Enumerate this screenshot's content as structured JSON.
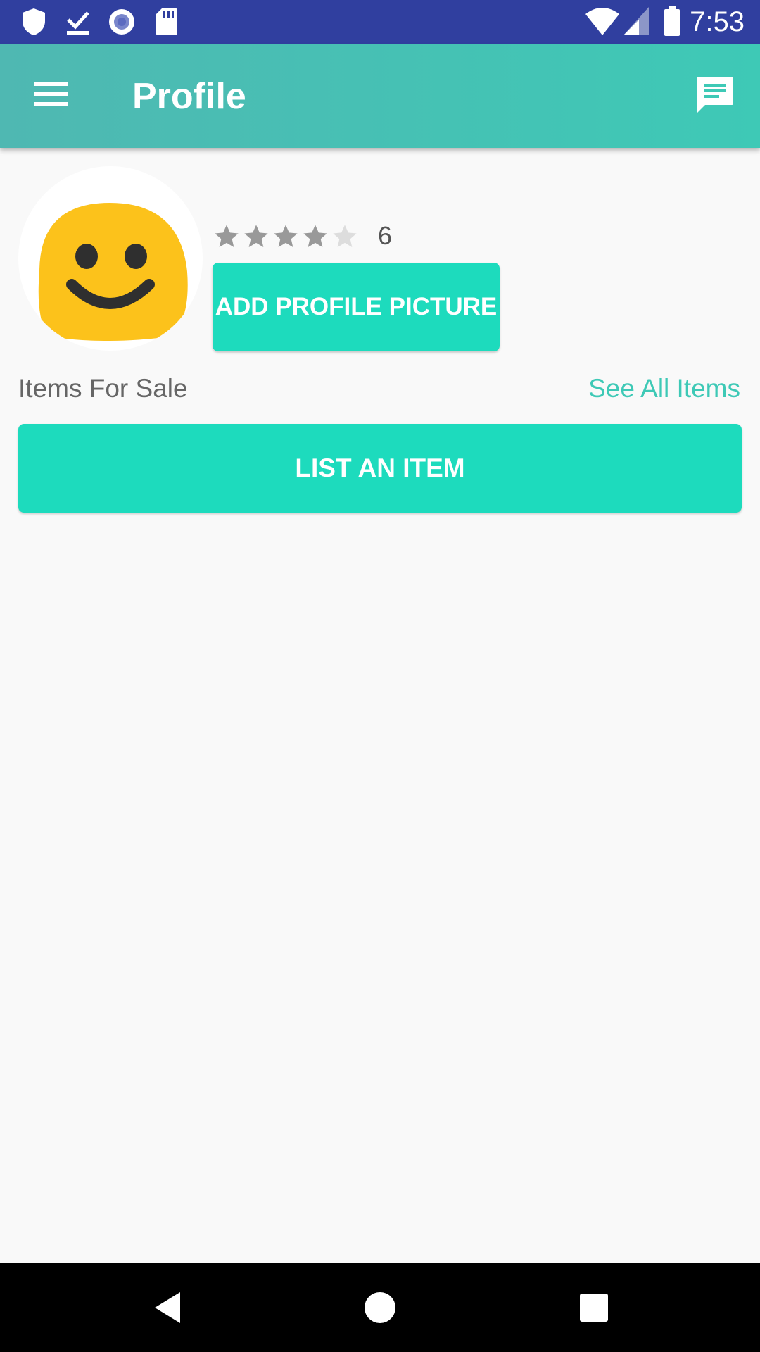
{
  "status_bar": {
    "time": "7:53",
    "left_icons": [
      "shield-icon",
      "download-done-icon",
      "record-icon",
      "sd-card-icon"
    ],
    "right_icons": [
      "wifi-icon",
      "cell-signal-icon",
      "battery-icon"
    ]
  },
  "app_bar": {
    "title": "Profile",
    "menu_icon": "hamburger-menu-icon",
    "action_icon": "chat-icon",
    "color": "#3ec9b6"
  },
  "profile": {
    "avatar_icon": "smiley-face-icon",
    "rating_stars": 4,
    "rating_max": 5,
    "rating_count": "6",
    "add_picture_label": "ADD PROFILE PICTURE"
  },
  "items_section": {
    "title": "Items For Sale",
    "see_all_label": "See All Items",
    "list_item_label": "LIST AN ITEM"
  },
  "nav_bar": {
    "icons": [
      "back-icon",
      "home-icon",
      "recents-icon"
    ]
  },
  "colors": {
    "status_bar": "#303f9f",
    "accent": "#1ddbbd",
    "link": "#3ec9b6",
    "background": "#f9f9f9"
  }
}
